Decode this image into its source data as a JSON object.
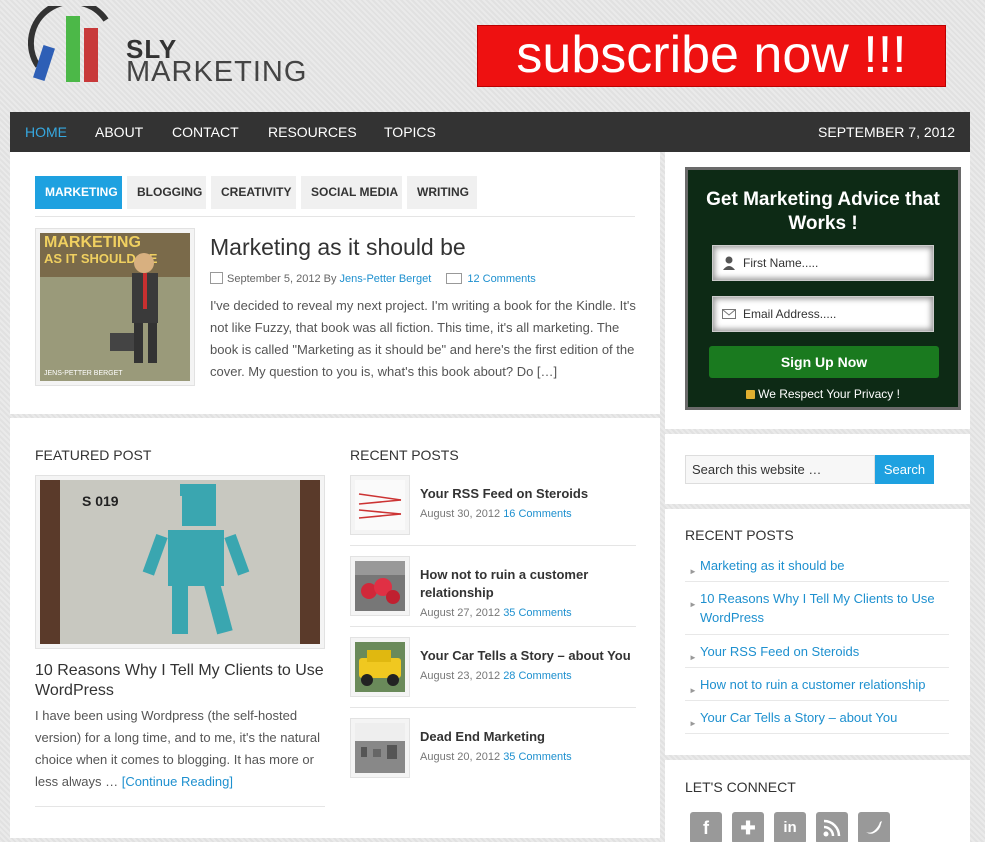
{
  "header": {
    "logo_line1": "SLY",
    "logo_line2": "MARKETING",
    "subscribe_banner": "subscribe now !!!"
  },
  "nav": {
    "items": [
      {
        "label": "HOME",
        "active": true
      },
      {
        "label": "ABOUT"
      },
      {
        "label": "CONTACT"
      },
      {
        "label": "RESOURCES"
      },
      {
        "label": "TOPICS"
      }
    ],
    "date": "SEPTEMBER 7, 2012"
  },
  "tabs": [
    "MARKETING",
    "BLOGGING",
    "CREATIVITY",
    "SOCIAL MEDIA",
    "WRITING"
  ],
  "lead_post": {
    "title": "Marketing as it should be",
    "date": "September 5, 2012",
    "by": "By",
    "author": "Jens-Petter Berget",
    "comments": "12 Comments",
    "excerpt": "I've decided to reveal my next project. I'm writing a book for the Kindle. It's not like Fuzzy, that book was all fiction. This time, it's all marketing. The book is called \"Marketing as it should be\" and here's the first edition of the cover. My question to you is, what's this book about? Do […]",
    "cover_text_top": "MARKETING",
    "cover_text_sub": "AS IT SHOULD BE",
    "cover_author": "JENS-PETTER BERGET"
  },
  "featured": {
    "heading": "FEATURED POST",
    "image_label": "S 019",
    "title": "10 Reasons Why I Tell My Clients to Use WordPress",
    "excerpt": "I have been using Wordpress (the self-hosted version) for a long time, and to me, it's the natural choice when it comes to blogging. It has more or less always …",
    "continue": "[Continue Reading]"
  },
  "recent": {
    "heading": "RECENT POSTS",
    "posts": [
      {
        "title": "Your RSS Feed on Steroids",
        "date": "August 30, 2012",
        "comments": "16 Comments"
      },
      {
        "title": "How not to ruin a customer relationship",
        "date": "August 27, 2012",
        "comments": "35 Comments"
      },
      {
        "title": "Your Car Tells a Story – about You",
        "date": "August 23, 2012",
        "comments": "28 Comments"
      },
      {
        "title": "Dead End Marketing",
        "date": "August 20, 2012",
        "comments": "35 Comments"
      }
    ]
  },
  "optin": {
    "title": "Get Marketing Advice that Works !",
    "first_name_placeholder": "First Name.....",
    "email_placeholder": "Email Address.....",
    "button": "Sign Up Now",
    "privacy": "We Respect Your Privacy !"
  },
  "search": {
    "placeholder": "Search this website …",
    "button": "Search"
  },
  "sidebar_recent": {
    "heading": "RECENT POSTS",
    "items": [
      "Marketing as it should be",
      "10 Reasons Why I Tell My Clients to Use WordPress",
      "Your RSS Feed on Steroids",
      "How not to ruin a customer relationship",
      "Your Car Tells a Story – about You"
    ]
  },
  "connect": {
    "heading": "LET'S CONNECT",
    "icons": [
      "facebook-icon",
      "google-plus-icon",
      "linkedin-icon",
      "rss-icon",
      "twitter-icon"
    ]
  },
  "colors": {
    "accent": "#1ea1e0",
    "nav_bg": "#333333",
    "subscribe_red": "#ee1111",
    "optin_green": "#1a7a1f"
  }
}
